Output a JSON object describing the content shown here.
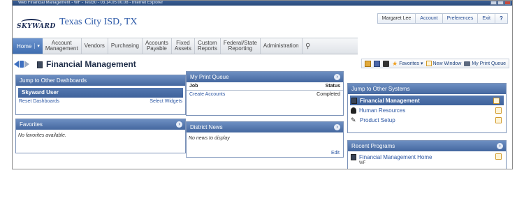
{
  "window": {
    "title": "Web Financial Management - WF - Test30 - 03.14.05.00.08 - Internet Explorer"
  },
  "header": {
    "logo_text": "SKYWARD",
    "district_name": "Texas City ISD, TX",
    "user_name": "Margaret Lee",
    "account_label": "Account",
    "preferences_label": "Preferences",
    "exit_label": "Exit",
    "help_label": "?"
  },
  "nav": {
    "home_label": "Home",
    "items": [
      {
        "line1": "Account",
        "line2": "Management"
      },
      {
        "line1": "Vendors",
        "line2": ""
      },
      {
        "line1": "Purchasing",
        "line2": ""
      },
      {
        "line1": "Accounts",
        "line2": "Payable"
      },
      {
        "line1": "Fixed",
        "line2": "Assets"
      },
      {
        "line1": "Custom",
        "line2": "Reports"
      },
      {
        "line1": "Federal/State",
        "line2": "Reporting"
      },
      {
        "line1": "Administration",
        "line2": ""
      }
    ]
  },
  "page": {
    "title": "Financial Management",
    "favorites_label": "Favorites",
    "new_window_label": "New Window",
    "print_queue_label": "My Print Queue"
  },
  "dashboards": {
    "header": "Jump to Other Dashboards",
    "user_label": "Skyward User",
    "reset_label": "Reset Dashboards",
    "select_widgets_label": "Select Widgets"
  },
  "favorites": {
    "header": "Favorites",
    "empty_text": "No favorites available."
  },
  "print_queue": {
    "header": "My Print Queue",
    "col_job": "Job",
    "col_status": "Status",
    "rows": [
      {
        "job": "Create Accounts",
        "status": "Completed"
      }
    ]
  },
  "district_news": {
    "header": "District News",
    "empty_text": "No news to display",
    "edit_label": "Edit"
  },
  "other_systems": {
    "header": "Jump to Other Systems",
    "items": [
      {
        "label": "Financial Management",
        "selected": true
      },
      {
        "label": "Human Resources",
        "selected": false
      },
      {
        "label": "Product Setup",
        "selected": false
      }
    ]
  },
  "recent_programs": {
    "header": "Recent Programs",
    "items": [
      {
        "label": "Financial Management Home",
        "sub": "WF"
      }
    ]
  }
}
